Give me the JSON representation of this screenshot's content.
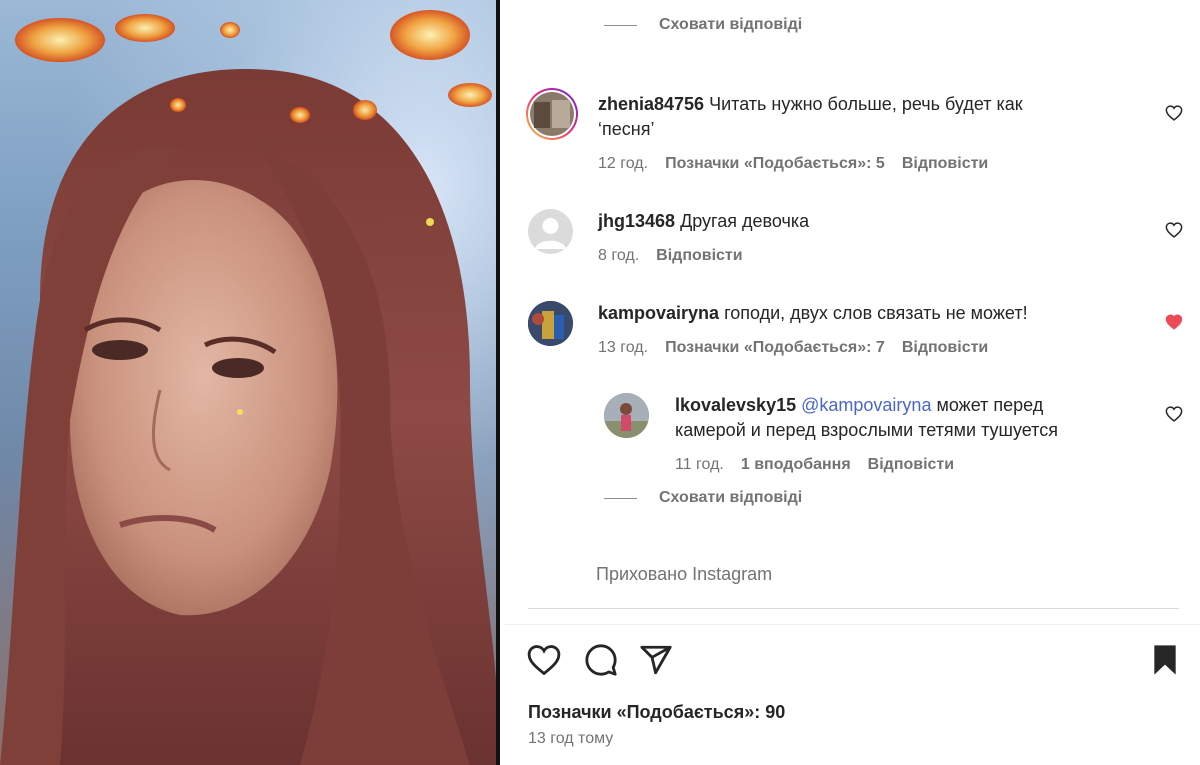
{
  "comments": [
    {
      "username": "zhenia84756",
      "text_line1": "Читать нужно больше, речь будет как",
      "text_line2": "‘песня’",
      "time": "12 год.",
      "likes": "Позначки «Подобається»: 5",
      "reply": "Відповісти",
      "liked": false
    },
    {
      "username": "jhg13468",
      "text_line1": "Другая девочка",
      "time": "8 год.",
      "reply": "Відповісти",
      "liked": false
    },
    {
      "username": "kampovairyna",
      "text_line1": "гоподи, двух слов связать не может!",
      "time": "13 год.",
      "likes": "Позначки «Подобається»: 7",
      "reply": "Відповісти",
      "liked": true
    }
  ],
  "reply_comment": {
    "username": "lkovalevsky15",
    "mention": "@kampovairyna",
    "text_line1": "может перед",
    "text_line2": "камерой и перед взрослыми тетями тушуется",
    "time": "11 год.",
    "likes": "1 вподобання",
    "reply": "Відповісти",
    "liked": false
  },
  "hide_replies_label": "Сховати відповіді",
  "hidden_by_instagram": "Приховано Instagram",
  "post": {
    "likes_label": "Позначки «Подобається»: 90",
    "time_ago": "13 год тому"
  },
  "icons": {
    "like": "heart-icon",
    "comment": "comment-icon",
    "share": "share-icon",
    "save": "bookmark-icon"
  },
  "colors": {
    "liked_heart": "#ed4956",
    "mention": "#4a67c8",
    "muted_text": "#737373"
  }
}
